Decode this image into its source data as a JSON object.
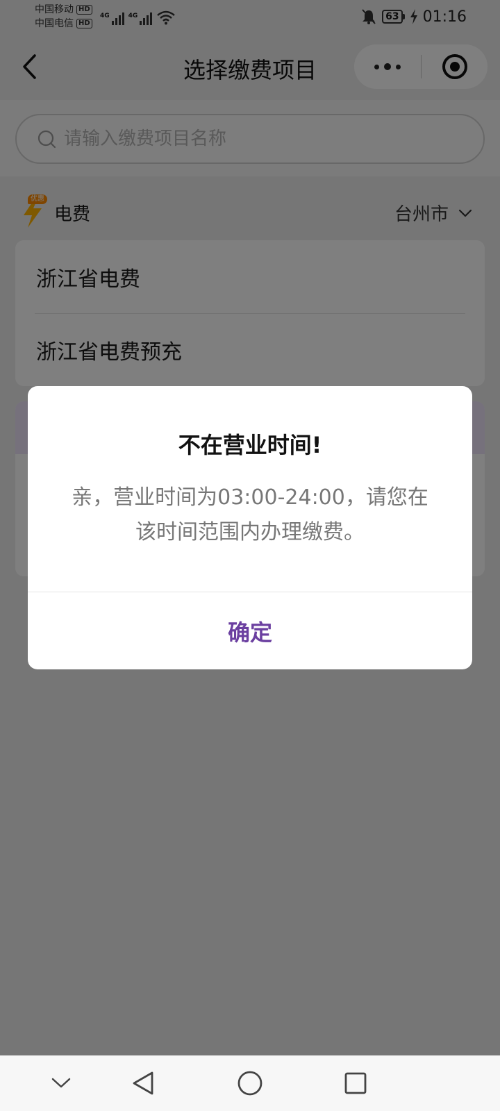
{
  "status_bar": {
    "carrier_1": "中国移动",
    "carrier_2": "中国电信",
    "hd_badge": "HD",
    "network_1": "4G",
    "network_2": "4G",
    "battery": "63",
    "time": "01:16"
  },
  "navbar": {
    "title": "选择缴费项目"
  },
  "search": {
    "placeholder": "请输入缴费项目名称"
  },
  "category": {
    "badge": "优惠",
    "name": "电费",
    "city": "台州市"
  },
  "items": [
    {
      "label": "浙江省电费"
    },
    {
      "label": "浙江省电费预充"
    }
  ],
  "dialog": {
    "title": "不在营业时间!",
    "message": "亲，营业时间为03:00-24:00，请您在该时间范围内办理缴费。",
    "confirm": "确定"
  },
  "colors": {
    "accent": "#6b3fa0",
    "overlay": "rgba(0,0,0,0.5)",
    "promo_banner": "#ece3f8",
    "category_icon": "#ffb300"
  },
  "icons": {
    "back": "back-arrow-icon",
    "more": "more-dots-icon",
    "close_miniprogram": "target-circle-icon",
    "search": "search-icon",
    "category": "lightning-icon",
    "city_dropdown": "chevron-down-icon",
    "nav_collapse": "chevron-down-icon",
    "nav_back": "triangle-back-icon",
    "nav_home": "circle-home-icon",
    "nav_recents": "square-recents-icon"
  }
}
